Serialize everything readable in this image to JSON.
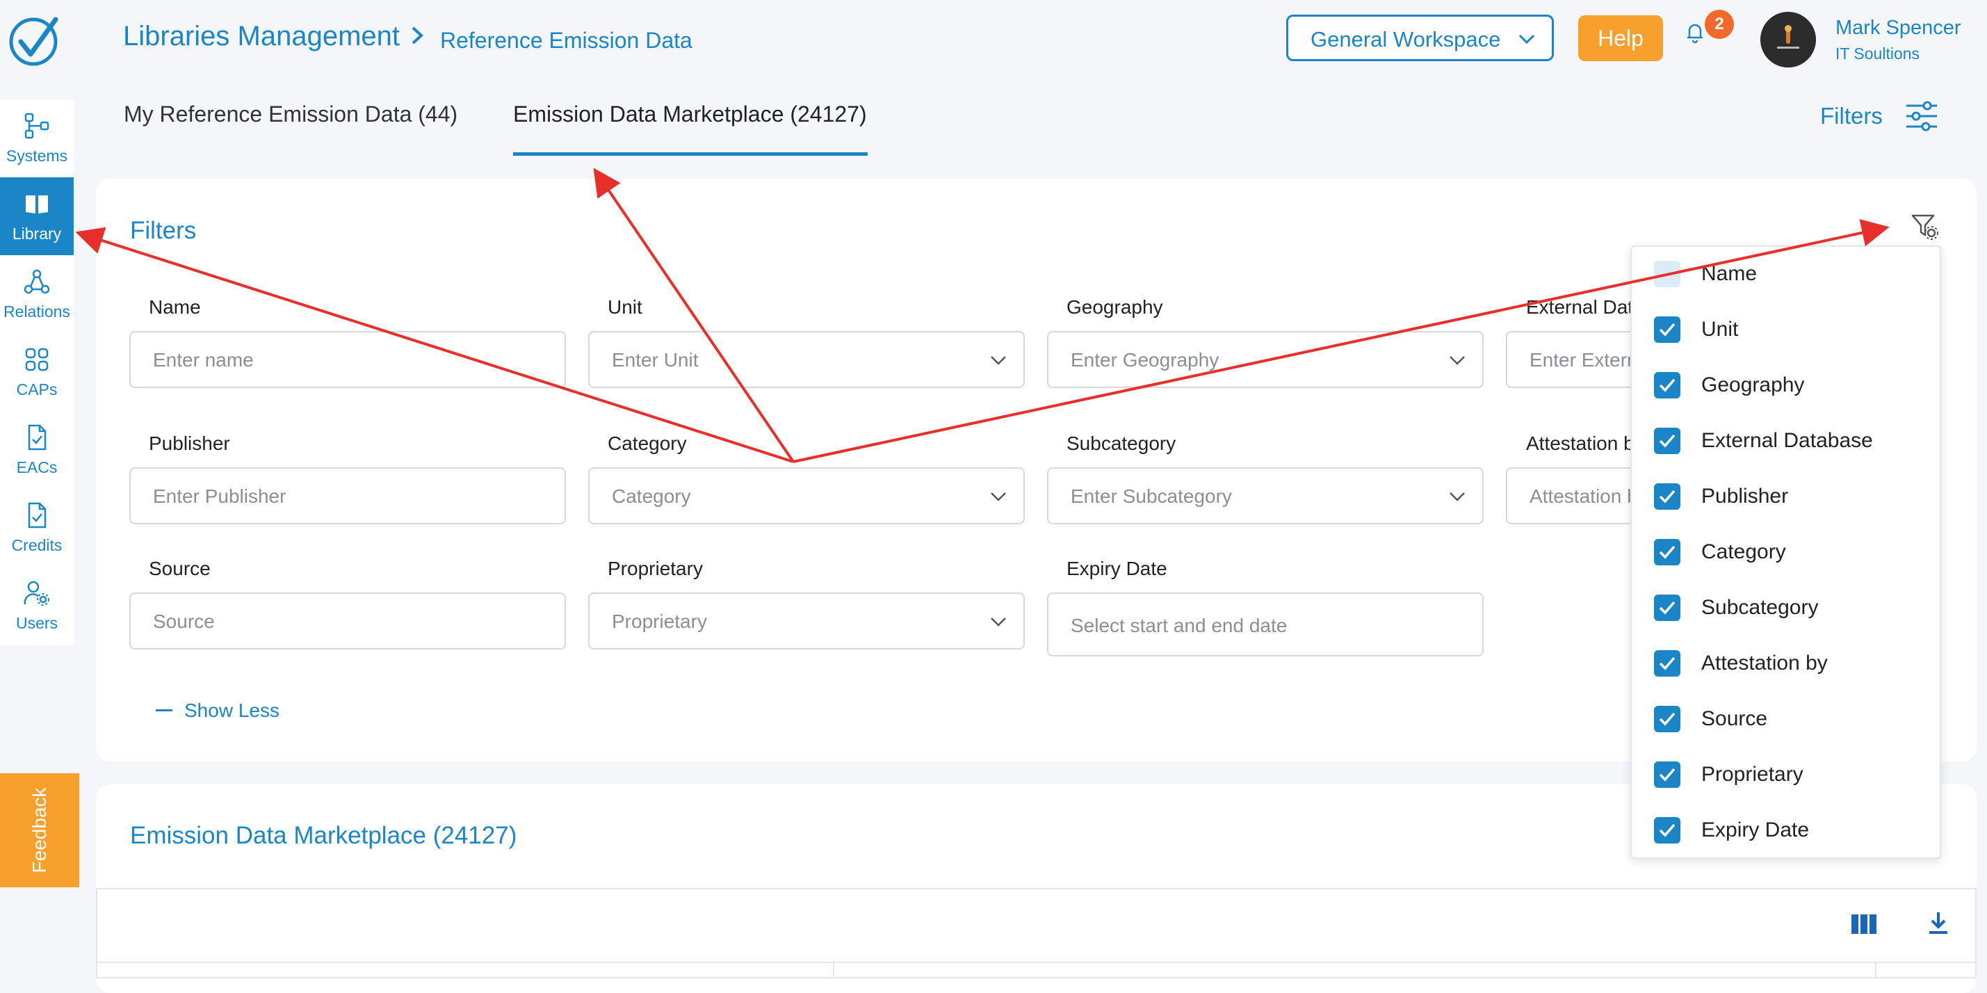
{
  "header": {
    "breadcrumb_main": "Libraries Management",
    "breadcrumb_sub": "Reference Emission Data",
    "workspace": "General Workspace",
    "help_label": "Help",
    "notification_count": "2",
    "user_name": "Mark Spencer",
    "user_org": "IT Soultions"
  },
  "sidebar": {
    "items": [
      {
        "label": "Systems",
        "icon": "systems-icon"
      },
      {
        "label": "Library",
        "icon": "book-icon"
      },
      {
        "label": "Relations",
        "icon": "relations-icon"
      },
      {
        "label": "CAPs",
        "icon": "grid-icon"
      },
      {
        "label": "EACs",
        "icon": "document-check-icon"
      },
      {
        "label": "Credits",
        "icon": "document-check-icon"
      },
      {
        "label": "Users",
        "icon": "users-gear-icon"
      }
    ],
    "active_index": 1,
    "feedback_label": "Feedback"
  },
  "tabs": [
    {
      "label": "My Reference Emission Data (44)",
      "active": false
    },
    {
      "label": "Emission Data Marketplace (24127)",
      "active": true
    }
  ],
  "filters_link": "Filters",
  "filter_card": {
    "title": "Filters",
    "fields": [
      {
        "label": "Name",
        "placeholder": "Enter name",
        "type": "text"
      },
      {
        "label": "Unit",
        "placeholder": "Enter Unit",
        "type": "select"
      },
      {
        "label": "Geography",
        "placeholder": "Enter Geography",
        "type": "select"
      },
      {
        "label": "External Dat",
        "placeholder": "Enter Extern",
        "type": "text"
      },
      {
        "label": "Publisher",
        "placeholder": "Enter Publisher",
        "type": "text"
      },
      {
        "label": "Category",
        "placeholder": "Category",
        "type": "select"
      },
      {
        "label": "Subcategory",
        "placeholder": "Enter Subcategory",
        "type": "select"
      },
      {
        "label": "Attestation b",
        "placeholder": "Attestation b",
        "type": "text"
      },
      {
        "label": "Source",
        "placeholder": "Source",
        "type": "text"
      },
      {
        "label": "Proprietary",
        "placeholder": "Proprietary",
        "type": "select"
      },
      {
        "label": "Expiry Date",
        "placeholder": "Select start and end date",
        "type": "date"
      }
    ],
    "show_less": "Show Less"
  },
  "column_dropdown": {
    "options": [
      {
        "label": "Name",
        "checked": true,
        "disabled": true
      },
      {
        "label": "Unit",
        "checked": true,
        "disabled": false
      },
      {
        "label": "Geography",
        "checked": true,
        "disabled": false
      },
      {
        "label": "External Database",
        "checked": true,
        "disabled": false
      },
      {
        "label": "Publisher",
        "checked": true,
        "disabled": false
      },
      {
        "label": "Category",
        "checked": true,
        "disabled": false
      },
      {
        "label": "Subcategory",
        "checked": true,
        "disabled": false
      },
      {
        "label": "Attestation by",
        "checked": true,
        "disabled": false
      },
      {
        "label": "Source",
        "checked": true,
        "disabled": false
      },
      {
        "label": "Proprietary",
        "checked": true,
        "disabled": false
      },
      {
        "label": "Expiry Date",
        "checked": true,
        "disabled": false
      }
    ]
  },
  "marketplace_card": {
    "title": "Emission Data Marketplace (24127)"
  },
  "colors": {
    "primary": "#1a86c8",
    "accent": "#f7a02e",
    "badge": "#f26a2b",
    "annotation": "#e8302a"
  }
}
